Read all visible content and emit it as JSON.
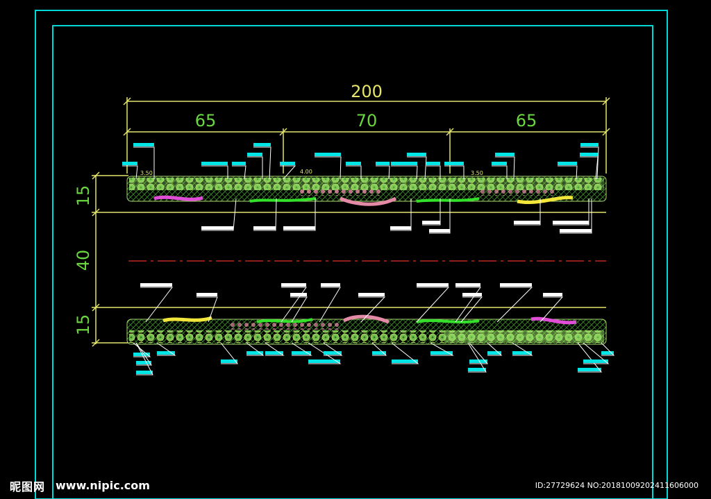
{
  "dimensions": {
    "overall": "200",
    "left_segment": "65",
    "middle_segment": "70",
    "right_segment": "65",
    "top_strip_width": "15",
    "median_width": "40",
    "bottom_strip_width": "15"
  },
  "small_annotations": {
    "top_left_scale": "3.50",
    "top_mid_scale": "4.00",
    "top_right_scale": "3.50"
  },
  "colors": {
    "frame": "#00ffff",
    "dimension": "#e5e56b",
    "dimension_text_green": "#6ad640",
    "centerline": "#c0281e",
    "label_box": "#00e5e5",
    "label_white": "#ffffff"
  },
  "watermark": {
    "logo": "昵图网",
    "url": "www.nipic.com",
    "id": "ID:27729624 NO:20181009202411606000"
  }
}
